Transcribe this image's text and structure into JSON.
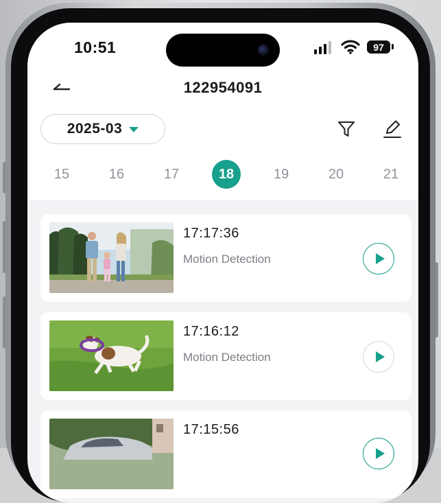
{
  "status_bar": {
    "time": "10:51",
    "battery": "97",
    "icons": [
      "cellular-signal-icon",
      "wifi-icon",
      "battery-icon"
    ]
  },
  "header": {
    "title": "122954091",
    "back_icon": "back-arrow-icon"
  },
  "toolbar": {
    "month": "2025-03",
    "filter_icon": "filter-funnel-icon",
    "edit_icon": "edit-pencil-icon"
  },
  "day_strip": {
    "days": [
      "15",
      "16",
      "17",
      "18",
      "19",
      "20",
      "21"
    ],
    "selected": "18"
  },
  "events": [
    {
      "time": "17:17:36",
      "type": "Motion Detection",
      "thumbnail": "family-walking-photo"
    },
    {
      "time": "17:16:12",
      "type": "Motion Detection",
      "thumbnail": "dog-running-photo"
    },
    {
      "time": "17:15:56",
      "type": "",
      "thumbnail": "car-in-driveway-photo"
    }
  ],
  "colors": {
    "accent": "#17a08b",
    "background": "#f2f3f5",
    "card": "#ffffff",
    "text_primary": "#1a1a1a",
    "text_secondary": "#7a7e84"
  }
}
